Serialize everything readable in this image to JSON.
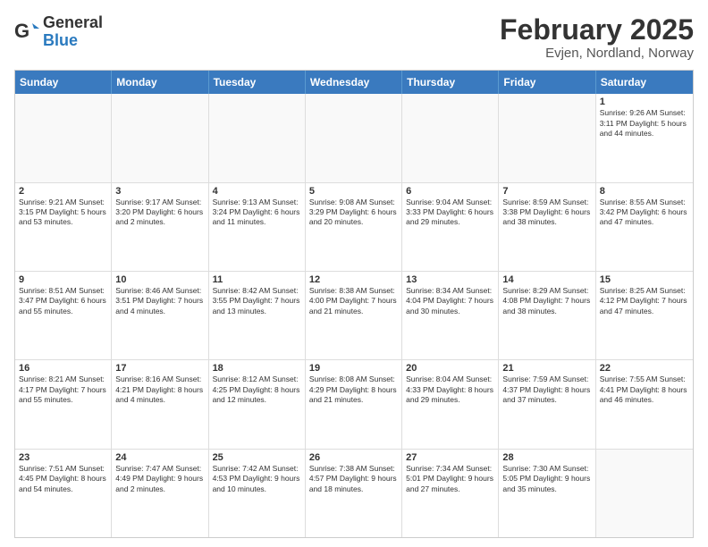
{
  "logo": {
    "general": "General",
    "blue": "Blue"
  },
  "title": "February 2025",
  "subtitle": "Evjen, Nordland, Norway",
  "weekdays": [
    "Sunday",
    "Monday",
    "Tuesday",
    "Wednesday",
    "Thursday",
    "Friday",
    "Saturday"
  ],
  "rows": [
    [
      {
        "day": "",
        "info": ""
      },
      {
        "day": "",
        "info": ""
      },
      {
        "day": "",
        "info": ""
      },
      {
        "day": "",
        "info": ""
      },
      {
        "day": "",
        "info": ""
      },
      {
        "day": "",
        "info": ""
      },
      {
        "day": "1",
        "info": "Sunrise: 9:26 AM\nSunset: 3:11 PM\nDaylight: 5 hours and 44 minutes."
      }
    ],
    [
      {
        "day": "2",
        "info": "Sunrise: 9:21 AM\nSunset: 3:15 PM\nDaylight: 5 hours and 53 minutes."
      },
      {
        "day": "3",
        "info": "Sunrise: 9:17 AM\nSunset: 3:20 PM\nDaylight: 6 hours and 2 minutes."
      },
      {
        "day": "4",
        "info": "Sunrise: 9:13 AM\nSunset: 3:24 PM\nDaylight: 6 hours and 11 minutes."
      },
      {
        "day": "5",
        "info": "Sunrise: 9:08 AM\nSunset: 3:29 PM\nDaylight: 6 hours and 20 minutes."
      },
      {
        "day": "6",
        "info": "Sunrise: 9:04 AM\nSunset: 3:33 PM\nDaylight: 6 hours and 29 minutes."
      },
      {
        "day": "7",
        "info": "Sunrise: 8:59 AM\nSunset: 3:38 PM\nDaylight: 6 hours and 38 minutes."
      },
      {
        "day": "8",
        "info": "Sunrise: 8:55 AM\nSunset: 3:42 PM\nDaylight: 6 hours and 47 minutes."
      }
    ],
    [
      {
        "day": "9",
        "info": "Sunrise: 8:51 AM\nSunset: 3:47 PM\nDaylight: 6 hours and 55 minutes."
      },
      {
        "day": "10",
        "info": "Sunrise: 8:46 AM\nSunset: 3:51 PM\nDaylight: 7 hours and 4 minutes."
      },
      {
        "day": "11",
        "info": "Sunrise: 8:42 AM\nSunset: 3:55 PM\nDaylight: 7 hours and 13 minutes."
      },
      {
        "day": "12",
        "info": "Sunrise: 8:38 AM\nSunset: 4:00 PM\nDaylight: 7 hours and 21 minutes."
      },
      {
        "day": "13",
        "info": "Sunrise: 8:34 AM\nSunset: 4:04 PM\nDaylight: 7 hours and 30 minutes."
      },
      {
        "day": "14",
        "info": "Sunrise: 8:29 AM\nSunset: 4:08 PM\nDaylight: 7 hours and 38 minutes."
      },
      {
        "day": "15",
        "info": "Sunrise: 8:25 AM\nSunset: 4:12 PM\nDaylight: 7 hours and 47 minutes."
      }
    ],
    [
      {
        "day": "16",
        "info": "Sunrise: 8:21 AM\nSunset: 4:17 PM\nDaylight: 7 hours and 55 minutes."
      },
      {
        "day": "17",
        "info": "Sunrise: 8:16 AM\nSunset: 4:21 PM\nDaylight: 8 hours and 4 minutes."
      },
      {
        "day": "18",
        "info": "Sunrise: 8:12 AM\nSunset: 4:25 PM\nDaylight: 8 hours and 12 minutes."
      },
      {
        "day": "19",
        "info": "Sunrise: 8:08 AM\nSunset: 4:29 PM\nDaylight: 8 hours and 21 minutes."
      },
      {
        "day": "20",
        "info": "Sunrise: 8:04 AM\nSunset: 4:33 PM\nDaylight: 8 hours and 29 minutes."
      },
      {
        "day": "21",
        "info": "Sunrise: 7:59 AM\nSunset: 4:37 PM\nDaylight: 8 hours and 37 minutes."
      },
      {
        "day": "22",
        "info": "Sunrise: 7:55 AM\nSunset: 4:41 PM\nDaylight: 8 hours and 46 minutes."
      }
    ],
    [
      {
        "day": "23",
        "info": "Sunrise: 7:51 AM\nSunset: 4:45 PM\nDaylight: 8 hours and 54 minutes."
      },
      {
        "day": "24",
        "info": "Sunrise: 7:47 AM\nSunset: 4:49 PM\nDaylight: 9 hours and 2 minutes."
      },
      {
        "day": "25",
        "info": "Sunrise: 7:42 AM\nSunset: 4:53 PM\nDaylight: 9 hours and 10 minutes."
      },
      {
        "day": "26",
        "info": "Sunrise: 7:38 AM\nSunset: 4:57 PM\nDaylight: 9 hours and 18 minutes."
      },
      {
        "day": "27",
        "info": "Sunrise: 7:34 AM\nSunset: 5:01 PM\nDaylight: 9 hours and 27 minutes."
      },
      {
        "day": "28",
        "info": "Sunrise: 7:30 AM\nSunset: 5:05 PM\nDaylight: 9 hours and 35 minutes."
      },
      {
        "day": "",
        "info": ""
      }
    ]
  ]
}
